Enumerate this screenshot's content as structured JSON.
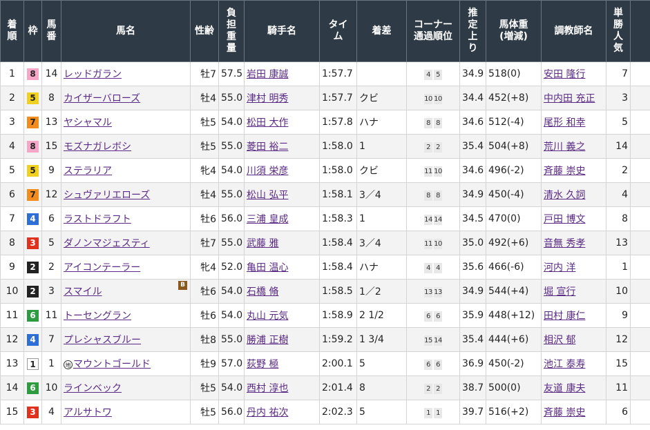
{
  "headers": {
    "rank": "着順",
    "waku": "枠",
    "umaban": "馬番",
    "horse": "馬名",
    "sexage": "性齢",
    "weight": "負担重量",
    "jockey": "騎手名",
    "time": "タイム",
    "margin": "着差",
    "corner": "コーナー通過順位",
    "last3f": "推定上り",
    "bodyweight_l1": "馬体重",
    "bodyweight_l2": "(増減)",
    "trainer": "調教師名",
    "pop": "単勝人気"
  },
  "rows": [
    {
      "rank": "1",
      "waku": "8",
      "umaban": "14",
      "horse": "レッドガラン",
      "blinker": "",
      "chihou": "",
      "sexage": "牡7",
      "weight": "57.5",
      "jockey": "岩田 康誠",
      "time": "1:57.7",
      "margin": "",
      "c1": "4",
      "c2": "5",
      "last3f": "34.9",
      "bw": "518(0)",
      "trainer": "安田 隆行",
      "pop": "7"
    },
    {
      "rank": "2",
      "waku": "5",
      "umaban": "8",
      "horse": "カイザーバローズ",
      "blinker": "",
      "chihou": "",
      "sexage": "牡4",
      "weight": "55.0",
      "jockey": "津村 明秀",
      "time": "1:57.7",
      "margin": "クビ",
      "c1": "10",
      "c2": "10",
      "last3f": "34.4",
      "bw": "452(+8)",
      "trainer": "中内田 充正",
      "pop": "3"
    },
    {
      "rank": "3",
      "waku": "7",
      "umaban": "13",
      "horse": "ヤシャマル",
      "blinker": "",
      "chihou": "",
      "sexage": "牡5",
      "weight": "54.0",
      "jockey": "松田 大作",
      "time": "1:57.8",
      "margin": "ハナ",
      "c1": "8",
      "c2": "8",
      "last3f": "34.6",
      "bw": "512(-4)",
      "trainer": "尾形 和幸",
      "pop": "5"
    },
    {
      "rank": "4",
      "waku": "8",
      "umaban": "15",
      "horse": "モズナガレボシ",
      "blinker": "",
      "chihou": "",
      "sexage": "牡5",
      "weight": "55.0",
      "jockey": "菱田 裕二",
      "time": "1:58.0",
      "margin": "1",
      "c1": "2",
      "c2": "2",
      "last3f": "35.4",
      "bw": "504(+8)",
      "trainer": "荒川 義之",
      "pop": "14"
    },
    {
      "rank": "5",
      "waku": "5",
      "umaban": "9",
      "horse": "ステラリア",
      "blinker": "",
      "chihou": "",
      "sexage": "牝4",
      "weight": "54.0",
      "jockey": "川須 栄彦",
      "time": "1:58.0",
      "margin": "クビ",
      "c1": "11",
      "c2": "10",
      "last3f": "34.6",
      "bw": "496(-2)",
      "trainer": "斉藤 崇史",
      "pop": "2"
    },
    {
      "rank": "6",
      "waku": "7",
      "umaban": "12",
      "horse": "シュヴァリエローズ",
      "blinker": "",
      "chihou": "",
      "sexage": "牡4",
      "weight": "55.0",
      "jockey": "松山 弘平",
      "time": "1:58.1",
      "margin": "3／4",
      "c1": "8",
      "c2": "8",
      "last3f": "34.9",
      "bw": "450(-4)",
      "trainer": "清水 久詞",
      "pop": "4"
    },
    {
      "rank": "7",
      "waku": "4",
      "umaban": "6",
      "horse": "ラストドラフト",
      "blinker": "",
      "chihou": "",
      "sexage": "牡6",
      "weight": "56.0",
      "jockey": "三浦 皇成",
      "time": "1:58.3",
      "margin": "1",
      "c1": "14",
      "c2": "14",
      "last3f": "34.5",
      "bw": "470(0)",
      "trainer": "戸田 博文",
      "pop": "8"
    },
    {
      "rank": "8",
      "waku": "3",
      "umaban": "5",
      "horse": "ダノンマジェスティ",
      "blinker": "",
      "chihou": "",
      "sexage": "牡7",
      "weight": "55.0",
      "jockey": "武藤 雅",
      "time": "1:58.4",
      "margin": "3／4",
      "c1": "11",
      "c2": "10",
      "last3f": "35.0",
      "bw": "492(+6)",
      "trainer": "音無 秀孝",
      "pop": "13"
    },
    {
      "rank": "9",
      "waku": "2",
      "umaban": "2",
      "horse": "アイコンテーラー",
      "blinker": "",
      "chihou": "",
      "sexage": "牝4",
      "weight": "52.0",
      "jockey": "亀田 温心",
      "time": "1:58.4",
      "margin": "ハナ",
      "c1": "4",
      "c2": "4",
      "last3f": "35.6",
      "bw": "466(-6)",
      "trainer": "河内 洋",
      "pop": "1"
    },
    {
      "rank": "10",
      "waku": "2",
      "umaban": "3",
      "horse": "スマイル",
      "blinker": "B",
      "chihou": "",
      "sexage": "牡6",
      "weight": "54.0",
      "jockey": "石橋 脩",
      "time": "1:58.5",
      "margin": "1／2",
      "c1": "13",
      "c2": "13",
      "last3f": "34.9",
      "bw": "544(+4)",
      "trainer": "堀 宣行",
      "pop": "10"
    },
    {
      "rank": "11",
      "waku": "6",
      "umaban": "11",
      "horse": "トーセングラン",
      "blinker": "",
      "chihou": "",
      "sexage": "牡6",
      "weight": "54.0",
      "jockey": "丸山 元気",
      "time": "1:58.9",
      "margin": "2 1/2",
      "c1": "6",
      "c2": "6",
      "last3f": "35.9",
      "bw": "448(+12)",
      "trainer": "田村 康仁",
      "pop": "9"
    },
    {
      "rank": "12",
      "waku": "4",
      "umaban": "7",
      "horse": "プレシャスブルー",
      "blinker": "",
      "chihou": "",
      "sexage": "牡8",
      "weight": "55.0",
      "jockey": "勝浦 正樹",
      "time": "1:59.2",
      "margin": "1 3/4",
      "c1": "15",
      "c2": "14",
      "last3f": "35.4",
      "bw": "444(+6)",
      "trainer": "相沢 郁",
      "pop": "12"
    },
    {
      "rank": "13",
      "waku": "1",
      "umaban": "1",
      "horse": "マウントゴールド",
      "blinker": "",
      "chihou": "地",
      "sexage": "牡9",
      "weight": "57.0",
      "jockey": "荻野 極",
      "time": "2:00.1",
      "margin": "5",
      "c1": "6",
      "c2": "6",
      "last3f": "36.9",
      "bw": "450(-2)",
      "trainer": "池江 泰寿",
      "pop": "15"
    },
    {
      "rank": "14",
      "waku": "6",
      "umaban": "10",
      "horse": "ラインベック",
      "blinker": "",
      "chihou": "",
      "sexage": "牡5",
      "weight": "54.0",
      "jockey": "西村 淳也",
      "time": "2:01.4",
      "margin": "8",
      "c1": "2",
      "c2": "2",
      "last3f": "38.7",
      "bw": "500(0)",
      "trainer": "友道 康夫",
      "pop": "11"
    },
    {
      "rank": "15",
      "waku": "3",
      "umaban": "4",
      "horse": "アルサトワ",
      "blinker": "",
      "chihou": "",
      "sexage": "牡5",
      "weight": "56.0",
      "jockey": "丹内 祐次",
      "time": "2:02.3",
      "margin": "5",
      "c1": "1",
      "c2": "1",
      "last3f": "39.7",
      "bw": "516(+2)",
      "trainer": "斉藤 崇史",
      "pop": "6"
    }
  ]
}
